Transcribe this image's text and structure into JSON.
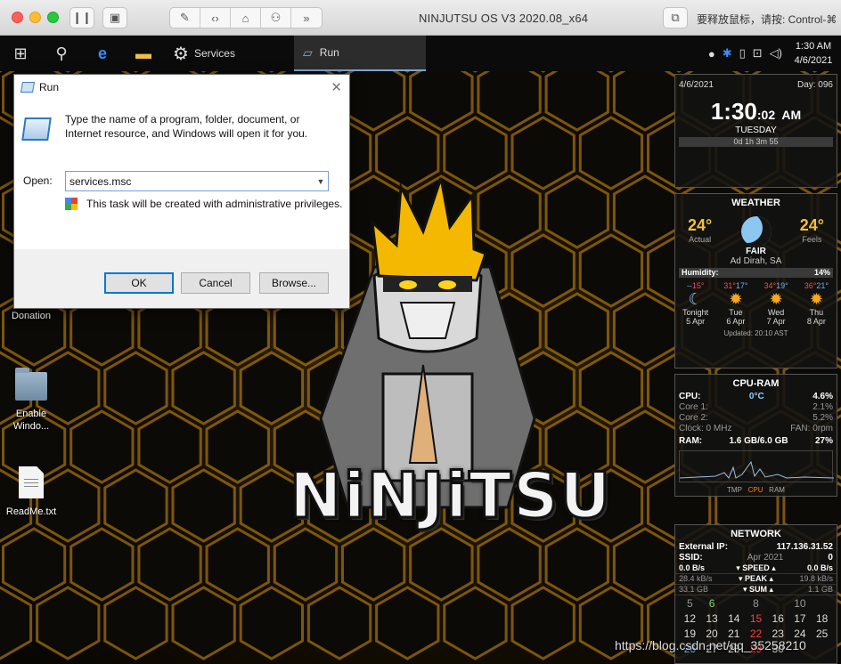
{
  "host": {
    "title": "NINJUTSU OS V3 2020.08_x64",
    "hint": "要释放鼠标，请按: Control-⌘"
  },
  "taskbar": {
    "services_label": "Services",
    "run_label": "Run",
    "time": "1:30 AM",
    "date": "4/6/2021"
  },
  "desktop_icons": [
    {
      "label": "Donation"
    },
    {
      "label": "Enable Windo..."
    },
    {
      "label": "ReadMe.txt"
    }
  ],
  "logo_text": "NiNJiTSU",
  "run_dialog": {
    "title": "Run",
    "description": "Type the name of a program, folder, document, or Internet resource, and Windows will open it for you.",
    "open_label": "Open:",
    "open_value": "services.msc",
    "admin_note": "This task will be created with administrative privileges.",
    "ok": "OK",
    "cancel": "Cancel",
    "browse": "Browse..."
  },
  "clock_widget": {
    "date": "4/6/2021",
    "day_of_year": "Day: 096",
    "time": "1:30",
    "seconds": ":02",
    "ampm": "AM",
    "weekday": "TUESDAY",
    "uptime": "0d 1h 3m 55"
  },
  "weather_widget": {
    "title": "WEATHER",
    "actual_temp": "24°",
    "actual_label": "Actual",
    "feels_temp": "24°",
    "feels_label": "Feels",
    "condition": "FAIR",
    "location": "Ad Dirah, SA",
    "humidity_label": "Humidity:",
    "humidity": "14%",
    "forecast": [
      {
        "lo": "--",
        "hi": "15°",
        "day": "Tonight",
        "date": "5 Apr"
      },
      {
        "lo": "31°",
        "hi": "17°",
        "day": "Tue",
        "date": "6 Apr"
      },
      {
        "lo": "34°",
        "hi": "19°",
        "day": "Wed",
        "date": "7 Apr"
      },
      {
        "lo": "36°",
        "hi": "21°",
        "day": "Thu",
        "date": "8 Apr"
      }
    ],
    "updated": "Updated: 20:10 AST"
  },
  "cpu_widget": {
    "title": "CPU-RAM",
    "cpu_label": "CPU:",
    "cpu_temp": "0°C",
    "cpu_pct": "4.6%",
    "core1_label": "Core 1:",
    "core1": "2.1%",
    "core2_label": "Core 2:",
    "core2": "5.2%",
    "clock": "Clock: 0 MHz",
    "fan": "FAN: 0rpm",
    "ram_label": "RAM:",
    "ram_value": "1.6 GB/6.0 GB",
    "ram_pct": "27%",
    "legend_tmp": "TMP",
    "legend_cpu": "CPU",
    "legend_ram": "RAM"
  },
  "network_widget": {
    "title": "NETWORK",
    "ext_ip_label": "External IP:",
    "ext_ip": "117.136.31.52",
    "ssid_label": "SSID:",
    "ssid_value": "0",
    "ssid_dim": "Apr 2021",
    "speed_l": "0.0 B/s",
    "speed_label": "▾ SPEED ▴",
    "speed_r": "0.0 B/s",
    "peak_l": "28.4 kB/s",
    "peak_label": "▾ PEAK ▴",
    "peak_r": "19.8 kB/s",
    "sum_l": "33.1 GB",
    "sum_label": "▾ SUM ▴",
    "sum_r": "1.1 GB",
    "cal_row0": [
      "5",
      "6",
      "",
      "8",
      "",
      "10",
      ""
    ],
    "cal_row1": [
      "12",
      "13",
      "14",
      "15",
      "16",
      "17",
      "18"
    ],
    "cal_row2": [
      "19",
      "20",
      "21",
      "22",
      "23",
      "24",
      "25"
    ],
    "cal_row3": [
      "26",
      "27",
      "28",
      "29",
      "30",
      "",
      ""
    ]
  },
  "watermark": "https://blog.csdn.net/qq_35258210"
}
